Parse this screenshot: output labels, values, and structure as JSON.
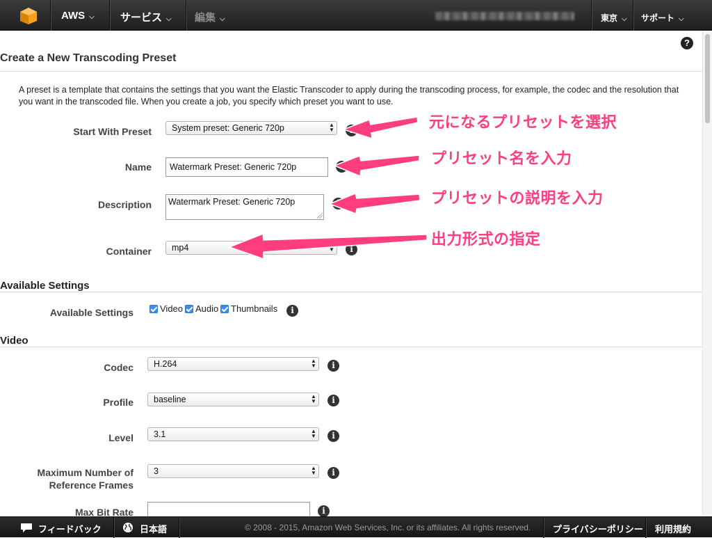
{
  "nav": {
    "brand": "AWS",
    "services": "サービス",
    "edit": "編集",
    "region": "東京",
    "support": "サポート"
  },
  "page": {
    "title": "Create a New Transcoding Preset",
    "intro": "A preset is a template that contains the settings that you want the Elastic Transcoder to apply during the transcoding process, for example, the codec and the resolution that you want in the transcoded file. When you create a job, you specify which preset you want to use."
  },
  "form": {
    "start_with_preset": {
      "label": "Start With Preset",
      "value": "System preset: Generic 720p"
    },
    "name": {
      "label": "Name",
      "value": "Watermark Preset: Generic 720p"
    },
    "description": {
      "label": "Description",
      "value": "Watermark Preset: Generic 720p"
    },
    "container": {
      "label": "Container",
      "value": "mp4"
    }
  },
  "available_settings": {
    "heading": "Available Settings",
    "label": "Available Settings",
    "options": [
      {
        "label": "Video",
        "checked": true
      },
      {
        "label": "Audio",
        "checked": true
      },
      {
        "label": "Thumbnails",
        "checked": true
      }
    ]
  },
  "video": {
    "heading": "Video",
    "codec": {
      "label": "Codec",
      "value": "H.264"
    },
    "profile": {
      "label": "Profile",
      "value": "baseline"
    },
    "level": {
      "label": "Level",
      "value": "3.1"
    },
    "max_ref_frames": {
      "label_line1": "Maximum Number of",
      "label_line2": "Reference Frames",
      "value": "3"
    },
    "max_bit_rate": {
      "label": "Max Bit Rate",
      "value": ""
    }
  },
  "annotations": [
    "元になるプリセットを選択",
    "プリセット名を入力",
    "プリセットの説明を入力",
    "出力形式の指定"
  ],
  "footer": {
    "feedback": "フィードバック",
    "language": "日本語",
    "copyright": "© 2008 - 2015, Amazon Web Services, Inc. or its affiliates. All rights reserved.",
    "privacy": "プライバシーポリシー",
    "terms": "利用規約"
  },
  "colors": {
    "annotation": "#ff3d7f",
    "nav_bg": "#2b2b2b",
    "checkbox": "#3a8ef0",
    "logo": "#f7a01c"
  },
  "icons": [
    "aws-cube-icon",
    "help-icon",
    "info-icon",
    "speech-bubble-icon",
    "globe-icon",
    "chevron-down-icon"
  ]
}
